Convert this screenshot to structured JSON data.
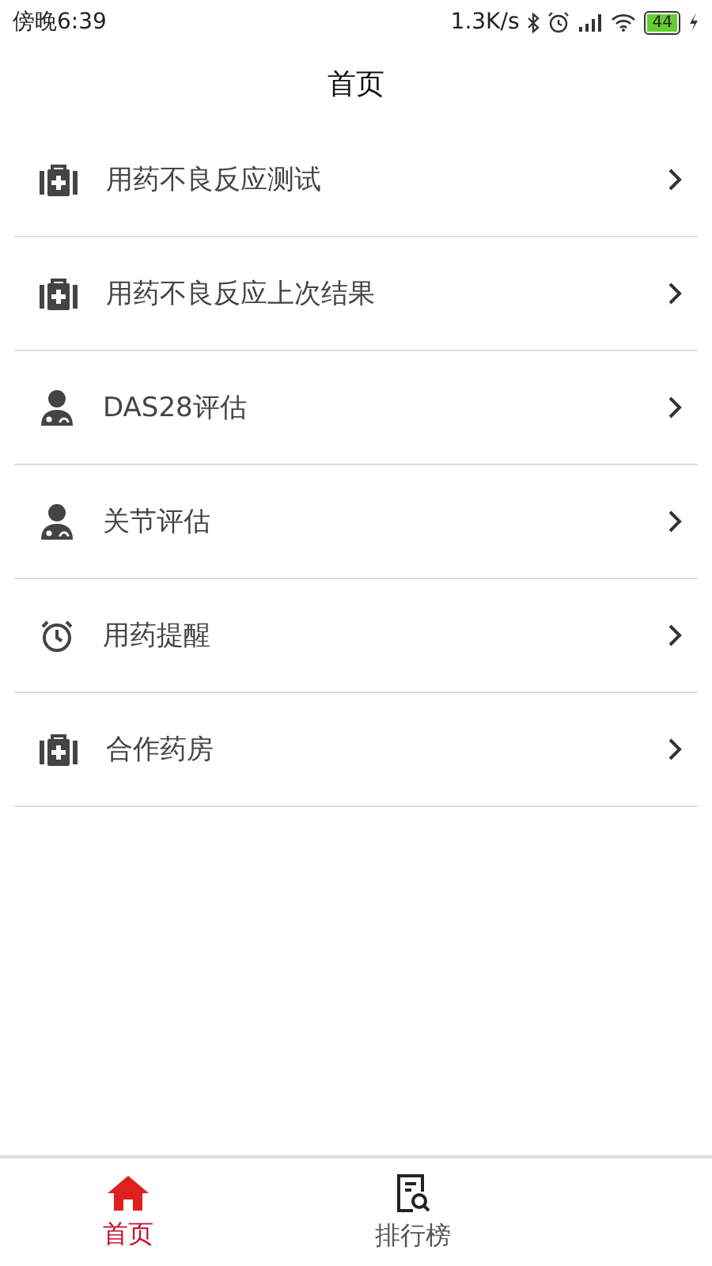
{
  "status_bar": {
    "time": "傍晚6:39",
    "speed": "1.3K/s",
    "battery": "44"
  },
  "header": {
    "title": "首页"
  },
  "items": [
    {
      "label": "用药不良反应测试",
      "kind": "kit"
    },
    {
      "label": "用药不良反应上次结果",
      "kind": "kit"
    },
    {
      "label": "DAS28评估",
      "kind": "doctor"
    },
    {
      "label": "关节评估",
      "kind": "doctor"
    },
    {
      "label": "用药提醒",
      "kind": "alarm"
    },
    {
      "label": "合作药房",
      "kind": "kit"
    }
  ],
  "tabs": [
    {
      "label": "首页",
      "kind": "home",
      "selected": true
    },
    {
      "label": "排行榜",
      "kind": "list",
      "selected": false
    }
  ]
}
